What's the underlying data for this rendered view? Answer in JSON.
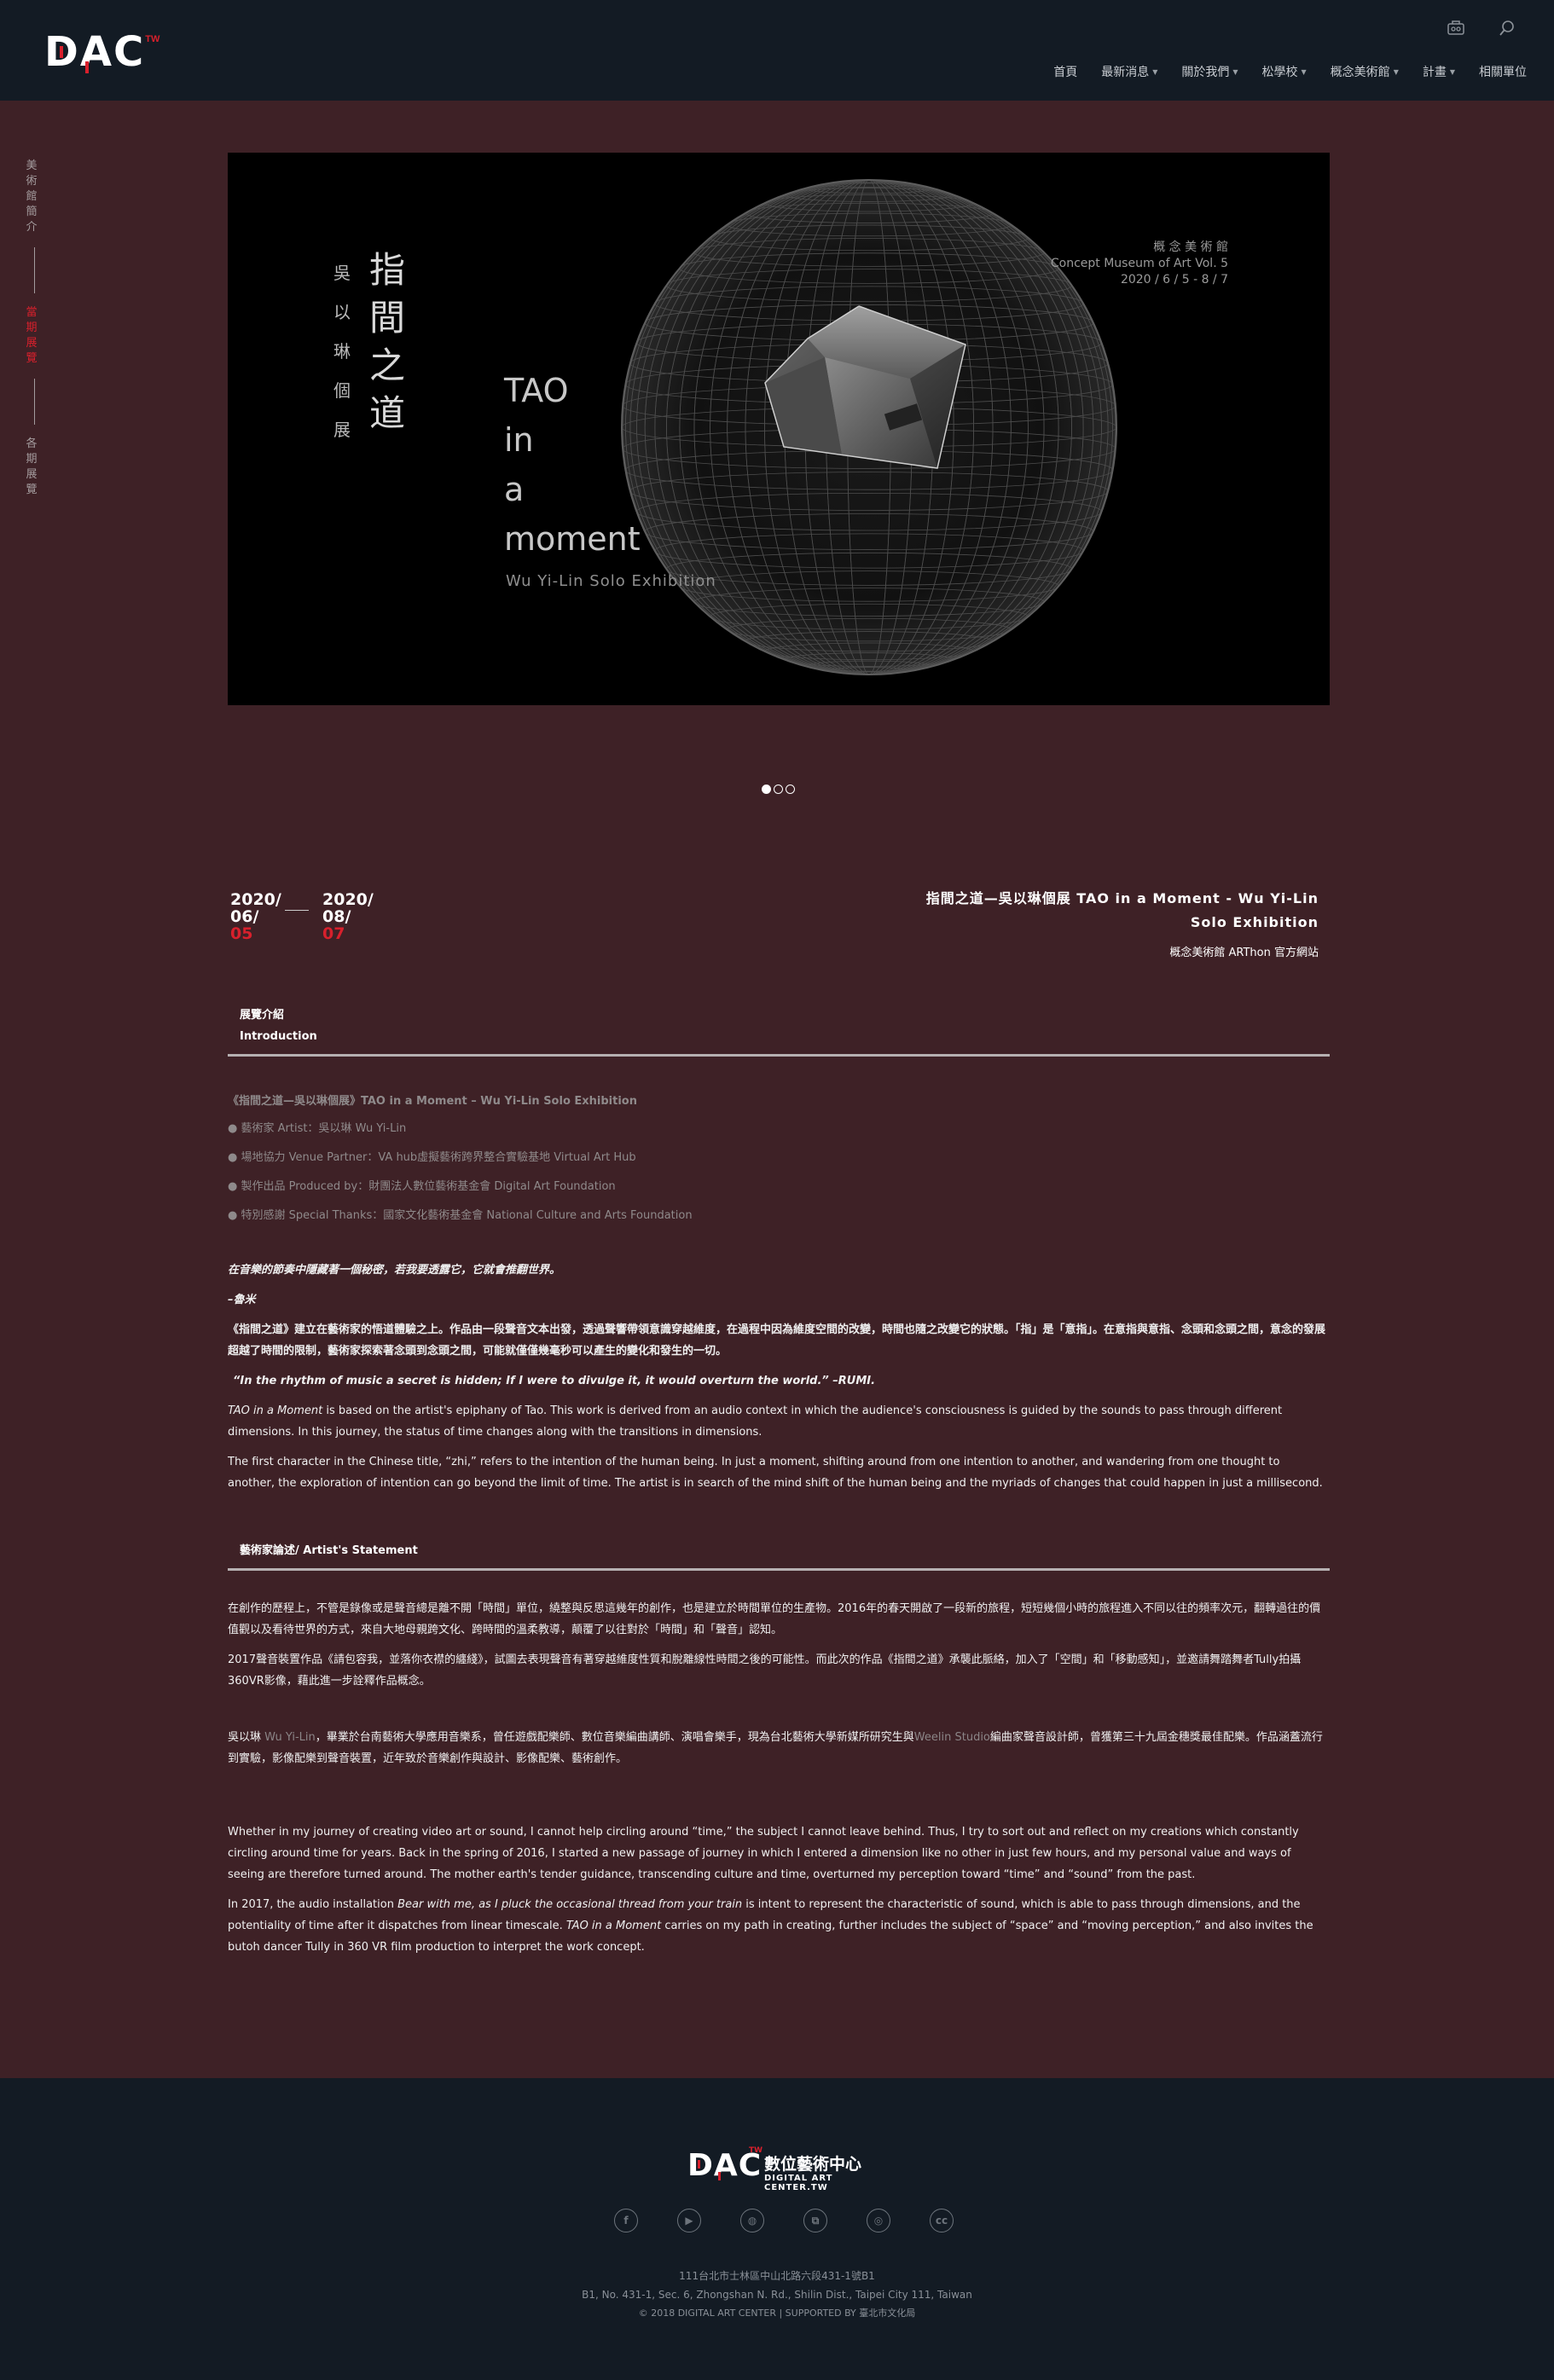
{
  "header": {
    "logo": {
      "text_d": "D",
      "text_a": "A",
      "text_c": "C",
      "tw": "TW"
    },
    "icons": [
      "ar-glasses-icon",
      "search-icon"
    ],
    "nav": [
      {
        "label": "首頁",
        "caret": false
      },
      {
        "label": "最新消息",
        "caret": true
      },
      {
        "label": "關於我們",
        "caret": true
      },
      {
        "label": "松學校",
        "caret": true
      },
      {
        "label": "概念美術館",
        "caret": true
      },
      {
        "label": "計畫",
        "caret": true
      },
      {
        "label": "相關單位",
        "caret": false
      }
    ]
  },
  "sidenav": {
    "items": [
      {
        "label": "美術館簡介",
        "active": false
      },
      {
        "label": "當期展覽",
        "active": true
      },
      {
        "label": "各期展覽",
        "active": false
      }
    ]
  },
  "banner": {
    "artist_cn": "吳以琳個展",
    "title_cn": "指間之道",
    "title_en_1": "TAO",
    "title_en_2": "in",
    "title_en_3": "a",
    "title_en_4": "moment",
    "subtitle_en": "Wu Yi-Lin Solo Exhibition",
    "venue_cn": "概 念 美 術 館",
    "venue_en": "Concept Museum of Art Vol. 5",
    "dates": "2020 / 6 / 5 - 8 / 7",
    "slides": 3,
    "active_slide": 1
  },
  "event": {
    "start": {
      "year": "2020/",
      "month": "06/",
      "day": "05"
    },
    "end": {
      "year": "2020/",
      "month": "08/",
      "day": "07"
    },
    "title": "指間之道—吳以琳個展 TAO in a Moment - Wu Yi-Lin Solo Exhibition",
    "organizer": "概念美術館 ARThon 官方網站"
  },
  "intro": {
    "heading_cn": "展覽介紹",
    "heading_en": "Introduction",
    "work_title": "《指間之道—吳以琳個展》TAO in a Moment – Wu Yi-Lin Solo Exhibition",
    "credits": [
      "藝術家 Artist：吳以琳 Wu Yi-Lin",
      "場地協力 Venue Partner：VA hub虛擬藝術跨界整合實驗基地 Virtual Art Hub",
      "製作出品 Produced by：財團法人數位藝術基金會 Digital Art Foundation",
      "特別感謝 Special Thanks：國家文化藝術基金會 National Culture and Arts Foundation"
    ],
    "quote_cn": "在音樂的節奏中隱藏著一個秘密，若我要透露它，它就會推翻世界。",
    "quote_author_cn": "–魯米",
    "para_cn": "《指間之道》建立在藝術家的悟道體驗之上。作品由一段聲音文本出發，透過聲響帶領意識穿越維度，在過程中因為維度空間的改變，時間也隨之改變它的狀態。「指」是「意指」。在意指與意指、念頭和念頭之間，意念的發展超越了時間的限制，藝術家探索著念頭到念頭之間，可能就僅僅幾毫秒可以產生的變化和發生的一切。",
    "quote_en": "“In the rhythm of music a secret is hidden; If I were to divulge it, it would overturn the world.” –RUMI.",
    "para_en_1_title": "TAO in a Moment",
    "para_en_1_rest": " is based on the artist's epiphany of Tao. This work is derived from an audio context in which the audience's consciousness is guided by the sounds to pass through different dimensions. In this journey, the status of time changes along with the transitions in dimensions.",
    "para_en_2": "The first character in the Chinese title, “zhi,” refers to the intention of the human being. In just a moment, shifting around from one intention to another, and wandering from one thought to another, the exploration of intention can go beyond the limit of time. The artist is in search of the mind shift of the human being and the myriads of changes that could happen in just a millisecond."
  },
  "statement": {
    "heading": "藝術家論述/ Artist's Statement",
    "para_cn_1": "在創作的歷程上，不管是錄像或是聲音總是離不開「時間」單位，繞整與反思這幾年的創作，也是建立於時間單位的生產物。2016年的春天開啟了一段新的旅程，短短幾個小時的旅程進入不同以往的頻率次元，翻轉過往的價值觀以及看待世界的方式，來自大地母親跨文化、跨時間的溫柔教導，顛覆了以往對於「時間」和「聲音」認知。",
    "para_cn_2": "2017聲音裝置作品《請包容我，並落你衣襟的纏綫》，試圖去表現聲音有著穿越維度性質和脫離線性時間之後的可能性。而此次的作品《指間之道》承襲此脈絡，加入了「空間」和「移動感知」，並邀請舞踏舞者Tully拍攝360VR影像，藉此進一步詮釋作品概念。",
    "bio_a": "吳以琳 ",
    "bio_name_en": "Wu Yi-Lin",
    "bio_b": "，畢業於台南藝術大學應用音樂系，曾任遊戲配樂師、數位音樂編曲講師、演唱會樂手，現為台北藝術大學新媒所研究生與",
    "bio_studio": "Weelin Studio",
    "bio_c": "編曲家聲音設計師，曾獲第三十九屆金穗獎最佳配樂。作品涵蓋流行到實驗，影像配樂到聲音裝置，近年致於音樂創作與設計、影像配樂、藝術創作。",
    "para_en_1": "Whether in my journey of creating video art or sound, I cannot help circling around “time,” the subject I cannot leave behind. Thus, I try to sort out and reflect on my creations which constantly circling around time for years. Back in the spring of 2016, I started a new passage of journey in which I entered a dimension like no other in just few hours, and my personal value and ways of seeing are therefore turned around. The mother earth's tender guidance, transcending culture and time, overturned my perception toward “time” and “sound” from the past.",
    "para_en_2_a": "In 2017, the audio installation ",
    "para_en_2_work": "Bear with me, as I pluck the occasional thread from your train",
    "para_en_2_b": " is intent to represent the characteristic of sound, which is able to pass through dimensions, and the potentiality of time after it dispatches from linear timescale. ",
    "para_en_2_work2": "TAO in a Moment",
    "para_en_2_c": " carries on my path in creating, further includes the subject of “space” and “moving perception,” and also invites the butoh dancer Tully in 360 VR film production to interpret the work concept."
  },
  "footer": {
    "logo_text": "DAC",
    "logo_tw": "TW",
    "name_cn": "數位藝術中心",
    "name_en": "DIGITAL ART CENTER.TW",
    "social": [
      "facebook-icon",
      "youtube-icon",
      "website-icon",
      "flickr-icon",
      "instagram-icon",
      "creative-commons-icon"
    ],
    "social_glyphs": [
      "f",
      "▶",
      "◍",
      "⧉",
      "◎",
      "cc"
    ],
    "address_cn": "111台北市士林區中山北路六段431-1號B1",
    "address_en": "B1, No. 431-1, Sec. 6, Zhongshan N. Rd., Shilin Dist., Taipei City 111, Taiwan",
    "copyright": "© 2018 DIGITAL ART CENTER  |  SUPPORTED BY 臺北市文化局"
  },
  "colors": {
    "accent": "#d8202c",
    "body_bg": "#3e2126",
    "header_bg": "#131b24"
  }
}
